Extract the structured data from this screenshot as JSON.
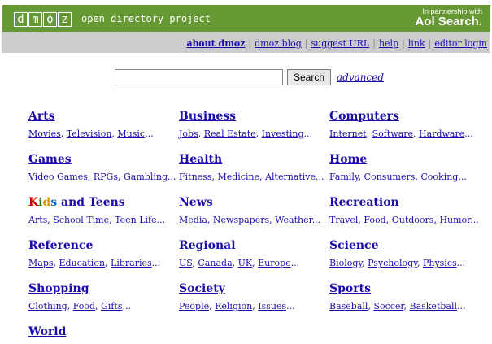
{
  "header": {
    "logo_letters": [
      "d",
      "m",
      "o",
      "z"
    ],
    "tagline": "open directory project",
    "partner_small": "In partnership with",
    "partner_big": "Aol Search."
  },
  "nav": {
    "items": [
      "about dmoz",
      "dmoz blog",
      "suggest URL",
      "help",
      "link",
      "editor login"
    ]
  },
  "search": {
    "input_value": "",
    "button_label": "Search",
    "advanced_label": "advanced"
  },
  "categories": [
    {
      "title": "Arts",
      "subs": [
        "Movies",
        "Television",
        "Music"
      ]
    },
    {
      "title": "Business",
      "subs": [
        "Jobs",
        "Real Estate",
        "Investing"
      ]
    },
    {
      "title": "Computers",
      "subs": [
        "Internet",
        "Software",
        "Hardware"
      ]
    },
    {
      "title": "Games",
      "subs": [
        "Video Games",
        "RPGs",
        "Gambling"
      ]
    },
    {
      "title": "Health",
      "subs": [
        "Fitness",
        "Medicine",
        "Alternative"
      ]
    },
    {
      "title": "Home",
      "subs": [
        "Family",
        "Consumers",
        "Cooking"
      ]
    },
    {
      "title": "Kids and Teens",
      "subs": [
        "Arts",
        "School Time",
        "Teen Life"
      ]
    },
    {
      "title": "News",
      "subs": [
        "Media",
        "Newspapers",
        "Weather"
      ]
    },
    {
      "title": "Recreation",
      "subs": [
        "Travel",
        "Food",
        "Outdoors",
        "Humor"
      ]
    },
    {
      "title": "Reference",
      "subs": [
        "Maps",
        "Education",
        "Libraries"
      ]
    },
    {
      "title": "Regional",
      "subs": [
        "US",
        "Canada",
        "UK",
        "Europe"
      ]
    },
    {
      "title": "Science",
      "subs": [
        "Biology",
        "Psychology",
        "Physics"
      ]
    },
    {
      "title": "Shopping",
      "subs": [
        "Clothing",
        "Food",
        "Gifts"
      ]
    },
    {
      "title": "Society",
      "subs": [
        "People",
        "Religion",
        "Issues"
      ]
    },
    {
      "title": "Sports",
      "subs": [
        "Baseball",
        "Soccer",
        "Basketball"
      ]
    },
    {
      "title": "World",
      "subs": []
    }
  ],
  "colors": {
    "header_bg": "#669933",
    "nav_bg": "#cccccc",
    "link": "#1a0dab"
  }
}
